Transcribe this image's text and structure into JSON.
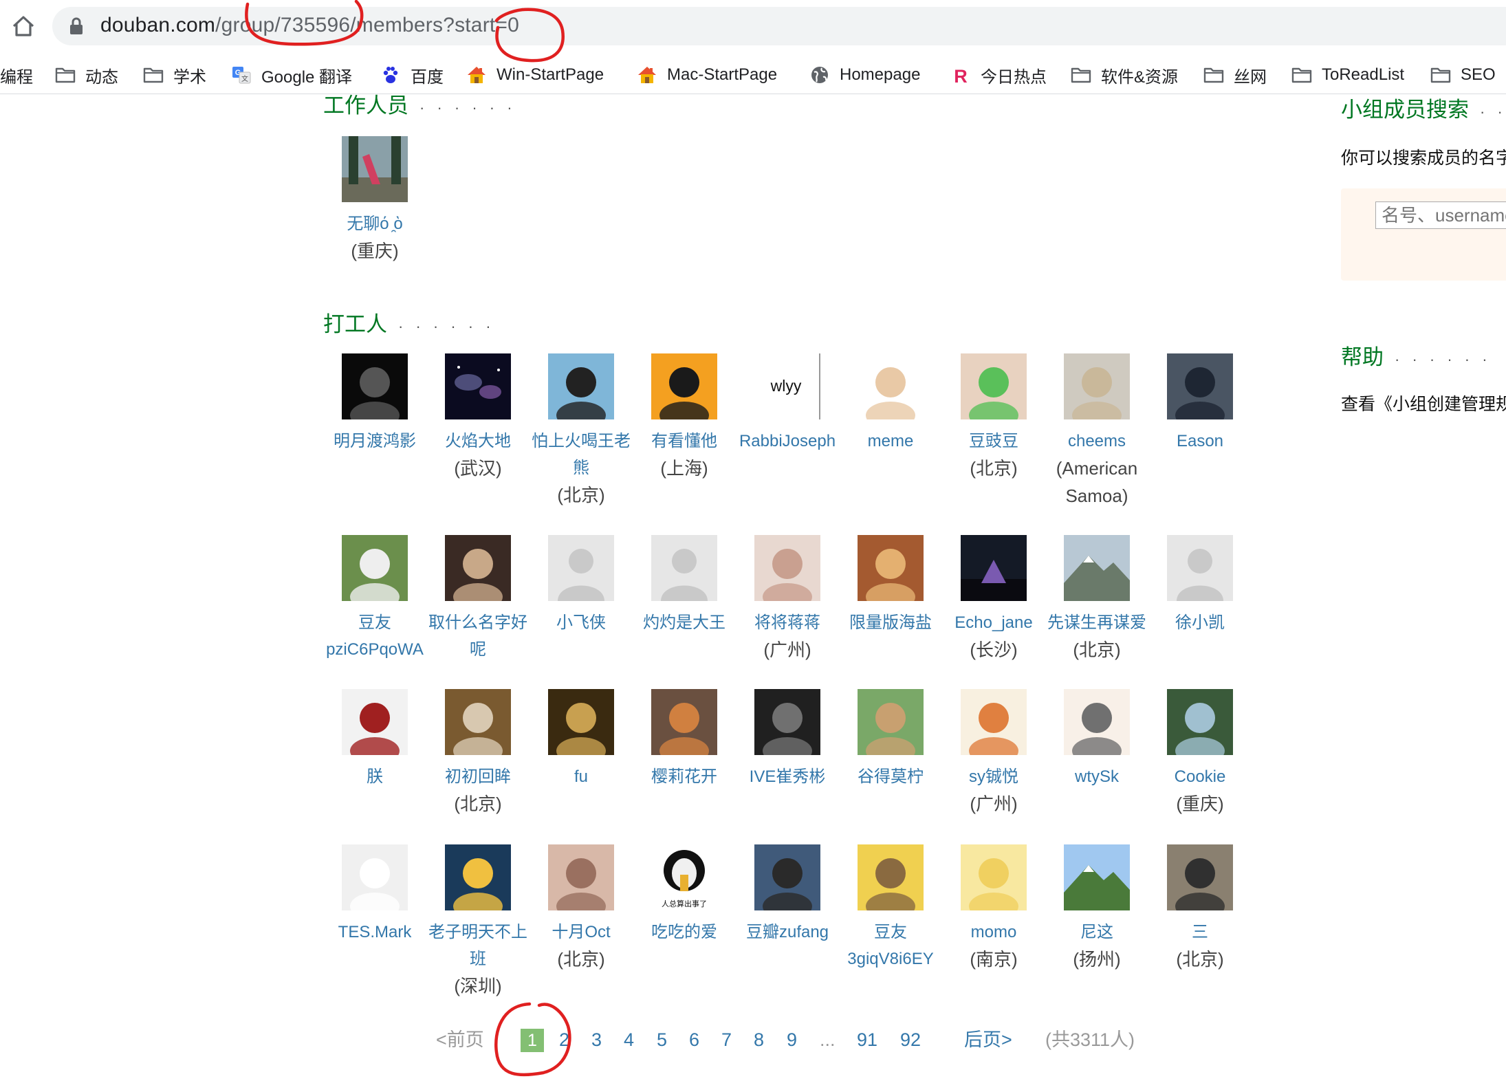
{
  "browser": {
    "url_host": "douban.com",
    "url_path": "/group/735596/members?start=0",
    "bookmarks": [
      {
        "label": "编程",
        "icon": "folder-icon"
      },
      {
        "label": "动态",
        "icon": "folder-icon"
      },
      {
        "label": "学术",
        "icon": "folder-icon"
      },
      {
        "label": "Google 翻译",
        "icon": "google-translate-icon"
      },
      {
        "label": "百度",
        "icon": "baidu-paw-icon"
      },
      {
        "label": "Win-StartPage",
        "icon": "house-icon"
      },
      {
        "label": "Mac-StartPage",
        "icon": "house-icon"
      },
      {
        "label": "Homepage",
        "icon": "globe-icon"
      },
      {
        "label": "今日热点",
        "icon": "r-logo-icon"
      },
      {
        "label": "软件&资源",
        "icon": "folder-icon"
      },
      {
        "label": "丝网",
        "icon": "folder-icon"
      },
      {
        "label": "ToReadList",
        "icon": "folder-icon"
      },
      {
        "label": "SEO",
        "icon": "folder-icon"
      }
    ]
  },
  "staff_section": {
    "heading": "工作人员",
    "members": [
      {
        "name": "无聊ό ̯ὸ",
        "location": "(重庆)"
      }
    ]
  },
  "workers_section": {
    "heading": "打工人",
    "members": [
      {
        "name": "明月渡鸿影",
        "location": ""
      },
      {
        "name": "火焰大地",
        "location": "(武汉)"
      },
      {
        "name": "怕上火喝王老熊",
        "location": "(北京)"
      },
      {
        "name": "有看懂他",
        "location": "(上海)"
      },
      {
        "name": "RabbiJoseph",
        "location": ""
      },
      {
        "name": "meme",
        "location": ""
      },
      {
        "name": "豆豉豆",
        "location": "(北京)"
      },
      {
        "name": "cheems",
        "location": "(American Samoa)"
      },
      {
        "name": "Eason",
        "location": ""
      },
      {
        "name": "豆友pziC6PqoWA",
        "location": ""
      },
      {
        "name": "取什么名字好呢",
        "location": ""
      },
      {
        "name": "小飞侠",
        "location": ""
      },
      {
        "name": "灼灼是大王",
        "location": ""
      },
      {
        "name": "将将蒋蒋",
        "location": "(广州)"
      },
      {
        "name": "限量版海盐",
        "location": ""
      },
      {
        "name": "Echo_jane",
        "location": "(长沙)"
      },
      {
        "name": "先谋生再谋爱",
        "location": "(北京)"
      },
      {
        "name": "徐小凯",
        "location": ""
      },
      {
        "name": "朕",
        "location": ""
      },
      {
        "name": "初初回眸",
        "location": "(北京)"
      },
      {
        "name": "fu",
        "location": ""
      },
      {
        "name": "樱莉花开",
        "location": ""
      },
      {
        "name": "IVE崔秀彬",
        "location": ""
      },
      {
        "name": "谷得莫柠",
        "location": ""
      },
      {
        "name": "sy铖悦",
        "location": "(广州)"
      },
      {
        "name": "wtySk",
        "location": ""
      },
      {
        "name": "Cookie",
        "location": "(重庆)"
      },
      {
        "name": "TES.Mark",
        "location": ""
      },
      {
        "name": "老子明天不上班",
        "location": "(深圳)"
      },
      {
        "name": "十月Oct",
        "location": "(北京)"
      },
      {
        "name": "吃吃的爱",
        "location": ""
      },
      {
        "name": "豆瓣zufang",
        "location": ""
      },
      {
        "name": "豆友3giqV8i6EY",
        "location": ""
      },
      {
        "name": "momo",
        "location": "(南京)"
      },
      {
        "name": "尼这",
        "location": "(扬州)"
      },
      {
        "name": "三",
        "location": "(北京)"
      }
    ],
    "avatar_text": {
      "rabbijoseph": "wlyy",
      "meme_sticker": "人总算出事了"
    }
  },
  "pagination": {
    "prev": "<前页",
    "current": "1",
    "pages": [
      "2",
      "3",
      "4",
      "5",
      "6",
      "7",
      "8",
      "9"
    ],
    "ellipsis": "...",
    "last_pages": [
      "91",
      "92"
    ],
    "next": "后页>",
    "total": "(共3311人)"
  },
  "sidebar": {
    "search_heading": "小组成员搜索",
    "search_hint": "你可以搜索成员的名字",
    "search_placeholder": "名号、username",
    "help_heading": "帮助",
    "help_text": "查看《小组创建管理规则》"
  },
  "colors": {
    "heading_green": "#007722",
    "link_blue": "#3377aa",
    "current_page_bg": "#83bf73",
    "ink_red": "#e02020"
  }
}
